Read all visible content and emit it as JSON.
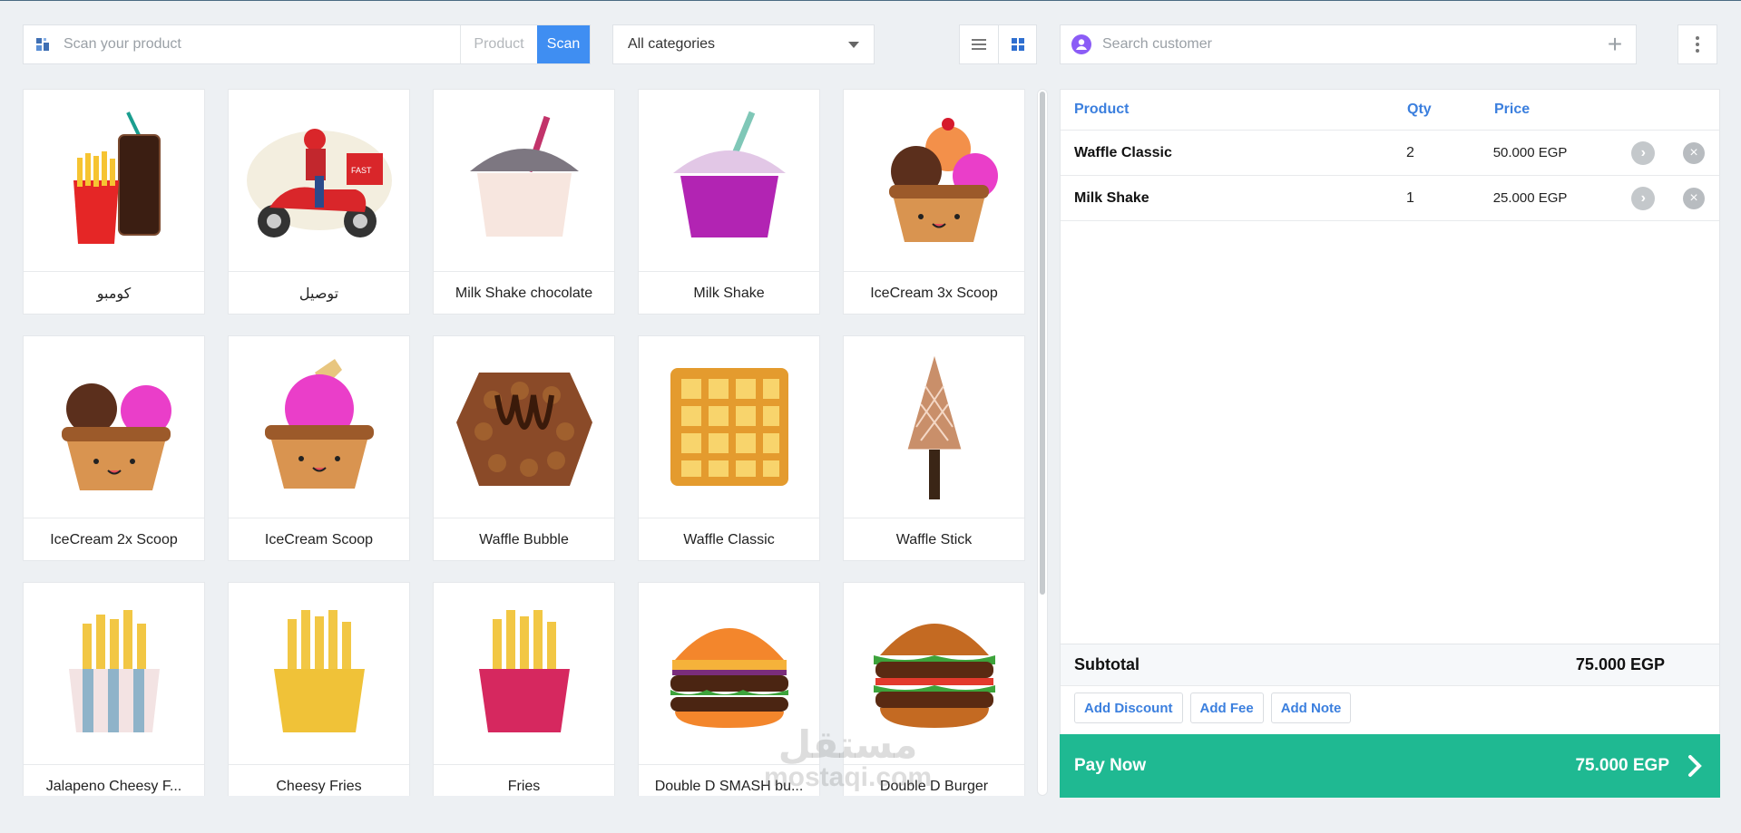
{
  "toolbar": {
    "scan_placeholder": "Scan your product",
    "product_label": "Product",
    "scan_button": "Scan",
    "category_value": "All categories",
    "customer_placeholder": "Search customer",
    "accent_color": "#3f8ef2"
  },
  "products": [
    {
      "name": "كومبو",
      "icon": "combo-icon"
    },
    {
      "name": "توصيل",
      "icon": "delivery-scooter-icon"
    },
    {
      "name": "Milk Shake chocolate",
      "icon": "milkshake-cup-icon"
    },
    {
      "name": "Milk Shake",
      "icon": "milkshake-purple-icon"
    },
    {
      "name": "IceCream 3x Scoop",
      "icon": "icecream-3-scoop-icon"
    },
    {
      "name": "IceCream 2x Scoop",
      "icon": "icecream-2-scoop-icon"
    },
    {
      "name": "IceCream Scoop",
      "icon": "icecream-scoop-icon"
    },
    {
      "name": "Waffle Bubble",
      "icon": "waffle-bubble-icon"
    },
    {
      "name": "Waffle Classic",
      "icon": "waffle-classic-icon"
    },
    {
      "name": "Waffle Stick",
      "icon": "waffle-stick-icon"
    },
    {
      "name": "Jalapeno Cheesy F...",
      "icon": "fries-striped-icon"
    },
    {
      "name": "Cheesy Fries",
      "icon": "fries-yellow-icon"
    },
    {
      "name": "Fries",
      "icon": "fries-pink-icon"
    },
    {
      "name": "Double D SMASH bu...",
      "icon": "burger-icon"
    },
    {
      "name": "Double D Burger",
      "icon": "burger-large-icon"
    }
  ],
  "cart": {
    "headers": {
      "product": "Product",
      "qty": "Qty",
      "price": "Price"
    },
    "items": [
      {
        "product": "Waffle Classic",
        "qty": "2",
        "price": "50.000 EGP"
      },
      {
        "product": "Milk Shake",
        "qty": "1",
        "price": "25.000 EGP"
      }
    ],
    "subtotal_label": "Subtotal",
    "subtotal_value": "75.000 EGP",
    "add_discount": "Add Discount",
    "add_fee": "Add Fee",
    "add_note": "Add Note",
    "pay_now": "Pay Now",
    "pay_total": "75.000 EGP",
    "pay_color": "#1fb992"
  },
  "watermark": {
    "line1": "مستقل",
    "line2": "mostaqi.com"
  }
}
